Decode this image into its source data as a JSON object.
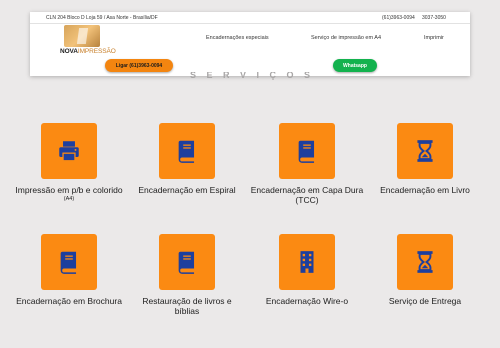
{
  "header": {
    "address": "CLN 204 Bloco D Loja 59 / Asa Norte - Brasília/DF",
    "phone1": "(61)3963-0094",
    "phone2": "3037-3050",
    "logo_word1": "NOVA",
    "logo_word2": "IMPRESSÃO",
    "nav": [
      "Encadernações especiais",
      "Serviço de impressão em A4",
      "Imprimir"
    ],
    "call_button": "Ligar (61)3963-0094",
    "whatsapp_button": "Whatsapp"
  },
  "section_title": "S E R V I Ç O S",
  "colors": {
    "accent": "#fb8a12",
    "icon": "#1d3f9e",
    "whatsapp": "#13b24e",
    "background": "#ebe9e9"
  },
  "services": [
    {
      "label": "Impressão em p/b e colorido",
      "sub": "(A4)",
      "icon": "printer-icon"
    },
    {
      "label": "Encadernação em Espiral",
      "icon": "book-icon"
    },
    {
      "label": "Encadernação em Capa Dura (TCC)",
      "icon": "book-icon"
    },
    {
      "label": "Encadernação em Livro",
      "icon": "hourglass-icon"
    },
    {
      "label": "Encadernação em Brochura",
      "icon": "book-icon"
    },
    {
      "label": "Restauração de livros e bíblias",
      "icon": "book-icon"
    },
    {
      "label": "Encadernação Wire-o",
      "icon": "building-icon"
    },
    {
      "label": "Serviço de Entrega",
      "icon": "hourglass-icon"
    }
  ]
}
